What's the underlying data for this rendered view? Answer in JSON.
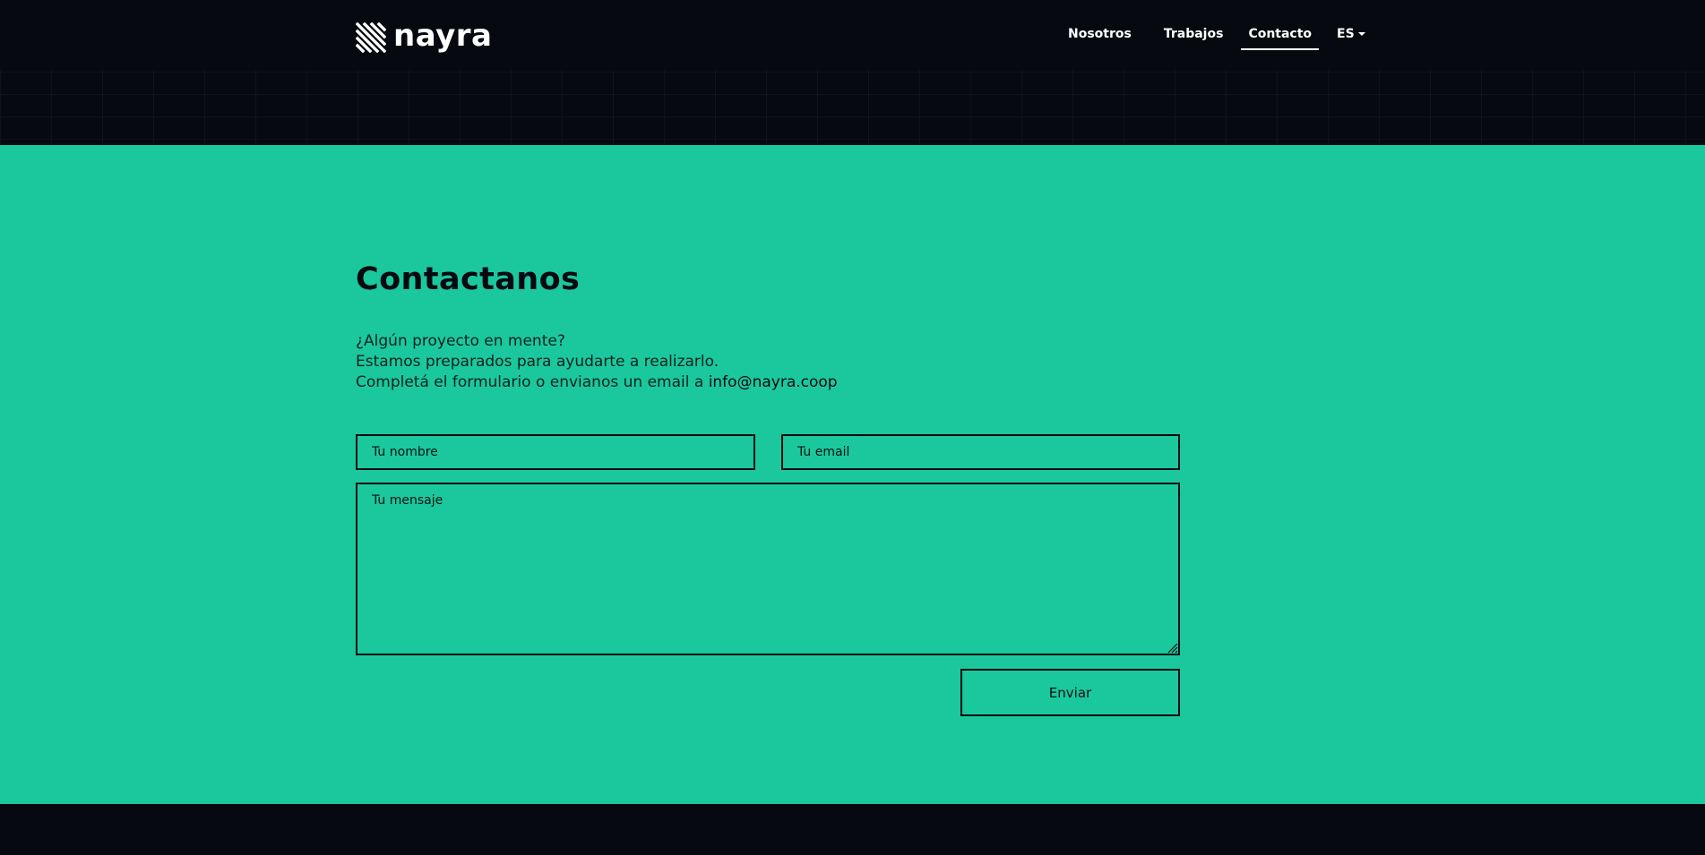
{
  "header": {
    "brand": "nayra",
    "logo_icon": "nayra-stripes-logo-icon",
    "nav": [
      {
        "label": "Nosotros"
      },
      {
        "label": "Trabajos"
      },
      {
        "label": "Contacto",
        "active": true
      }
    ],
    "language": {
      "label": "ES",
      "icon": "chevron-down-icon"
    }
  },
  "contact": {
    "title": "Contactanos",
    "intro_line1": "¿Algún proyecto en mente?",
    "intro_line2": "Estamos preparados para ayudarte a realizarlo.",
    "intro_line3": "Completá el formulario o envianos un email a ",
    "email": "info@nayra.coop",
    "form": {
      "name_placeholder": "Tu nombre",
      "email_placeholder": "Tu email",
      "message_placeholder": "Tu mensaje",
      "submit_label": "Enviar"
    }
  },
  "colors": {
    "background": "#060a10",
    "accent": "#1bc89e",
    "text_dark": "#060a10",
    "text_light": "#ffffff"
  }
}
